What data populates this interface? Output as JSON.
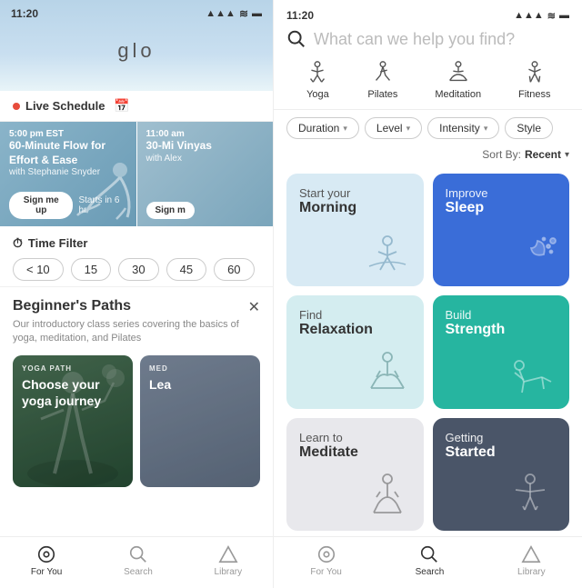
{
  "left": {
    "status": {
      "time": "11:20",
      "signal": "●●●",
      "wifi": "WiFi",
      "battery": "Battery"
    },
    "logo": "glo",
    "liveSchedule": {
      "label": "Live Schedule"
    },
    "classes": [
      {
        "time": "5:00 pm EST",
        "title": "60-Minute Flow for Effort & Ease",
        "instructor": "with Stephanie Snyder",
        "cta": "Sign me up",
        "starts": "Starts in 6 hr"
      },
      {
        "time": "11:00 am",
        "title": "30-Mi Vinyas",
        "instructor": "with Alex",
        "cta": "Sign m"
      }
    ],
    "timeFilter": {
      "label": "Time Filter",
      "pills": [
        "< 10",
        "15",
        "30",
        "45",
        "60"
      ]
    },
    "beginnersSection": {
      "title": "Beginner's Paths",
      "description": "Our introductory class series covering the basics of yoga, meditation, and Pilates"
    },
    "pathCards": [
      {
        "tag": "YOGA PATH",
        "title": "Choose your yoga journey"
      },
      {
        "tag": "MED",
        "title": "Lea"
      }
    ],
    "bottomNav": [
      {
        "label": "For You",
        "icon": "⊙",
        "active": true
      },
      {
        "label": "Search",
        "icon": "⌕",
        "active": false
      },
      {
        "label": "Library",
        "icon": "⬡",
        "active": false
      }
    ]
  },
  "right": {
    "status": {
      "time": "11:20",
      "signal": "●●●",
      "wifi": "WiFi",
      "battery": "Battery"
    },
    "search": {
      "placeholder": "What can we help you find?"
    },
    "categories": [
      {
        "label": "Yoga",
        "icon": "yoga"
      },
      {
        "label": "Pilates",
        "icon": "pilates"
      },
      {
        "label": "Meditation",
        "icon": "meditation"
      },
      {
        "label": "Fitness",
        "icon": "fitness"
      }
    ],
    "filters": [
      {
        "label": "Duration",
        "hasChevron": true
      },
      {
        "label": "Level",
        "hasChevron": true
      },
      {
        "label": "Intensity",
        "hasChevron": true
      },
      {
        "label": "Style",
        "hasChevron": false
      }
    ],
    "sort": {
      "label": "Sort By:",
      "value": "Recent"
    },
    "gridCards": [
      {
        "topText": "Start your",
        "boldText": "Morning",
        "colorClass": "light-blue",
        "icon": "stretch"
      },
      {
        "topText": "Improve",
        "boldText": "Sleep",
        "colorClass": "blue",
        "icon": "moon",
        "textWhite": true
      },
      {
        "topText": "Find",
        "boldText": "Relaxation",
        "colorClass": "light-teal",
        "icon": "meditate"
      },
      {
        "topText": "Build",
        "boldText": "Strength",
        "colorClass": "teal",
        "icon": "strength",
        "textWhite": true
      },
      {
        "topText": "Learn to",
        "boldText": "Meditate",
        "colorClass": "light-gray",
        "icon": "sit"
      },
      {
        "topText": "Getting",
        "boldText": "Started",
        "colorClass": "dark-gray",
        "icon": "pose",
        "textWhite": true
      }
    ],
    "bottomNav": [
      {
        "label": "For You",
        "icon": "⊙",
        "active": false
      },
      {
        "label": "Search",
        "icon": "⌕",
        "active": true
      },
      {
        "label": "Library",
        "icon": "⬡",
        "active": false
      }
    ]
  }
}
